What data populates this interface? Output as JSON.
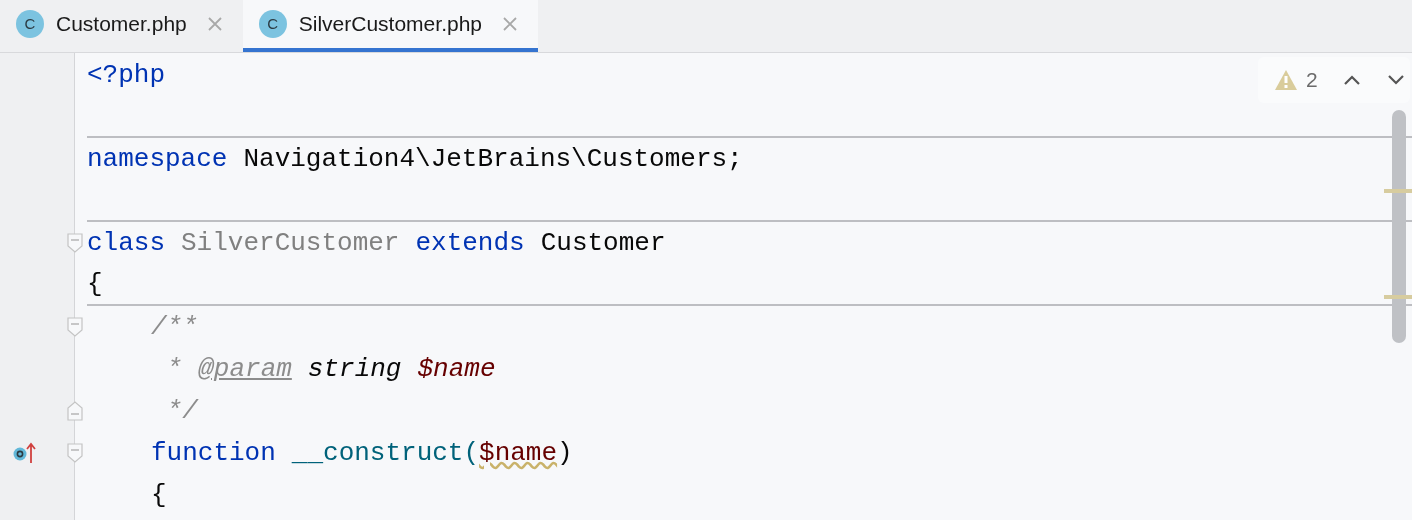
{
  "tabs": [
    {
      "icon_letter": "C",
      "label": "Customer.php",
      "selected": false
    },
    {
      "icon_letter": "C",
      "label": "SilverCustomer.php",
      "selected": true
    }
  ],
  "inspections": {
    "warning_count": "2"
  },
  "lines": [
    {
      "tokens": [
        {
          "kind": "keyword",
          "text": "<?php"
        }
      ]
    },
    {
      "separator": true
    },
    {
      "tokens": [
        {
          "kind": "keyword",
          "text": "namespace"
        },
        {
          "kind": "plain",
          "text": "Navigation4\\JetBrains\\Customers;"
        }
      ]
    },
    {
      "separator": true
    },
    {
      "fold_start": true,
      "tokens": [
        {
          "kind": "keyword",
          "text": "class"
        },
        {
          "kind": "unused",
          "text": "SilverCustomer"
        },
        {
          "kind": "keyword",
          "text": "extends"
        },
        {
          "kind": "plain",
          "text": "Customer"
        }
      ]
    },
    {
      "tokens": [
        {
          "kind": "plain",
          "text": "{"
        }
      ],
      "separator": true,
      "children": [
        {
          "fold_start": true,
          "tokens": [
            {
              "kind": "comment",
              "text": "/**"
            }
          ]
        },
        {
          "tokens": [
            {
              "kind": "comment",
              "text": " *"
            },
            {
              "kind": "doctag",
              "text": "@param"
            },
            {
              "kind": "doctype",
              "text": "string"
            },
            {
              "kind": "docvar",
              "text": "$name"
            }
          ]
        },
        {
          "fold_end": true,
          "tokens": [
            {
              "kind": "comment",
              "text": " */"
            }
          ]
        },
        {
          "fold_start": true,
          "override_marker": true,
          "tokens": [
            {
              "kind": "keyword",
              "text": "function"
            },
            {
              "kind": "function",
              "text": "__construct("
            },
            {
              "kind": "param",
              "text": "$name"
            },
            {
              "kind": "plain",
              "text": ")"
            }
          ]
        },
        {
          "tokens": [
            {
              "kind": "plain",
              "text": "{"
            }
          ]
        }
      ]
    }
  ]
}
